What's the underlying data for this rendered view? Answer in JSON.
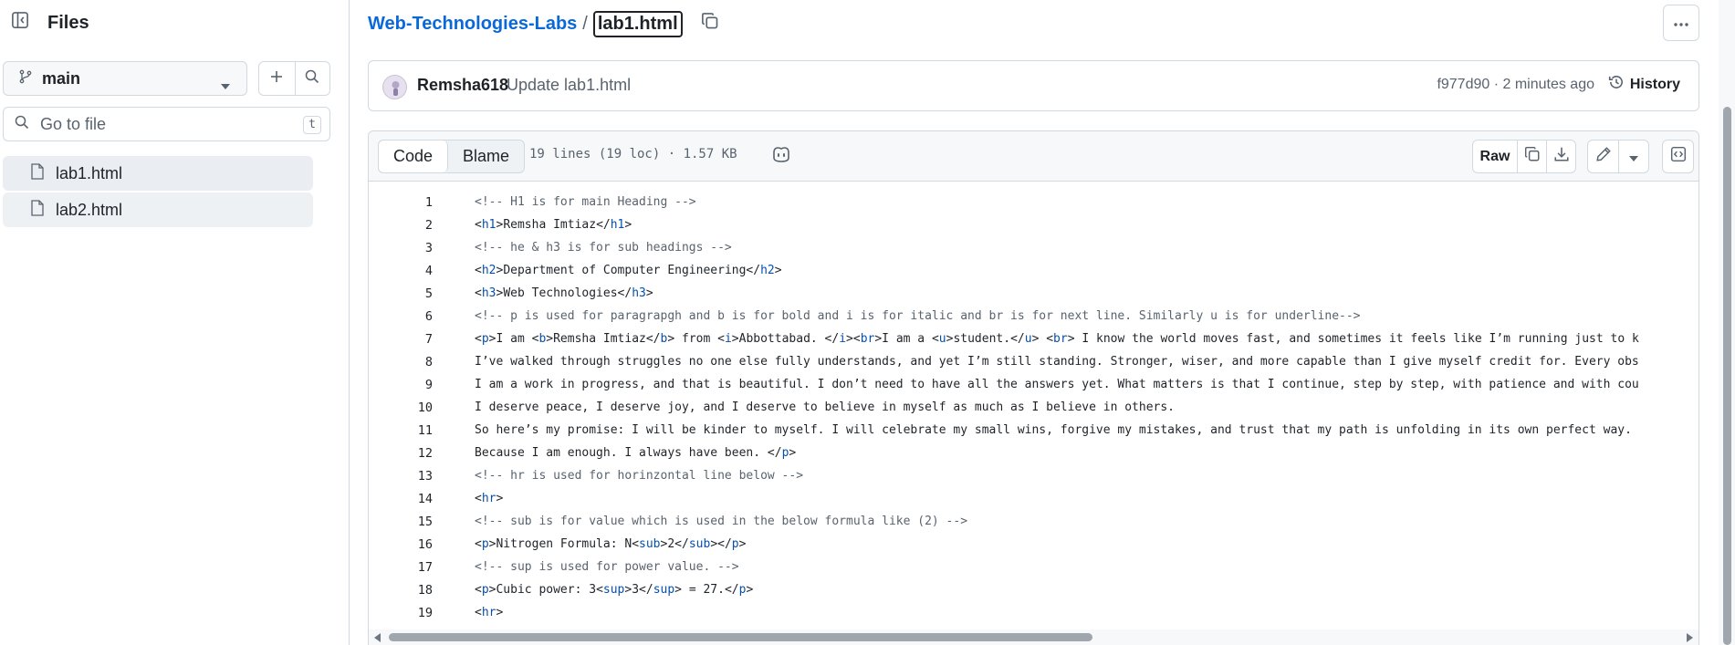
{
  "sidebar": {
    "title": "Files",
    "branch": "main",
    "search_placeholder": "Go to file",
    "search_shortcut": "t",
    "files": [
      {
        "name": "lab1.html",
        "active": true
      },
      {
        "name": "lab2.html",
        "active": false
      }
    ]
  },
  "breadcrumb": {
    "repo": "Web-Technologies-Labs",
    "separator": "/",
    "file": "lab1.html"
  },
  "commit": {
    "author": "Remsha618",
    "message": "Update lab1.html",
    "hash_time": "f977d90 · 2 minutes ago",
    "history_label": "History"
  },
  "file_header": {
    "tabs": [
      "Code",
      "Blame"
    ],
    "active_tab": "Code",
    "meta": "19 lines (19 loc) · 1.57 KB",
    "raw_label": "Raw"
  },
  "code_lines": [
    {
      "n": "1",
      "text": "<!-- H1 is for main Heading -->",
      "comment": true
    },
    {
      "n": "2",
      "text": "<h1>Remsha Imtiaz</h1>",
      "comment": false
    },
    {
      "n": "3",
      "text": "<!-- he & h3 is for sub headings -->",
      "comment": true
    },
    {
      "n": "4",
      "text": "<h2>Department of Computer Engineering</h2>",
      "comment": false
    },
    {
      "n": "5",
      "text": "<h3>Web Technologies</h3>",
      "comment": false
    },
    {
      "n": "6",
      "text": "<!-- p is used for paragrapgh and b is for bold and i is for italic and br is for next line. Similarly u is for underline-->",
      "comment": true
    },
    {
      "n": "7",
      "text": "<p>I am <b>Remsha Imtiaz</b> from <i>Abbottabad. </i><br>I am a <u>student.</u> <br> I know the world moves fast, and sometimes it feels like I’m running just to k",
      "comment": false
    },
    {
      "n": "8",
      "text": "I’ve walked through struggles no one else fully understands, and yet I’m still standing. Stronger, wiser, and more capable than I give myself credit for. Every obs",
      "comment": false
    },
    {
      "n": "9",
      "text": "I am a work in progress, and that is beautiful. I don’t need to have all the answers yet. What matters is that I continue, step by step, with patience and with cou",
      "comment": false
    },
    {
      "n": "10",
      "text": "I deserve peace, I deserve joy, and I deserve to believe in myself as much as I believe in others.",
      "comment": false
    },
    {
      "n": "11",
      "text": "So here’s my promise: I will be kinder to myself. I will celebrate my small wins, forgive my mistakes, and trust that my path is unfolding in its own perfect way.",
      "comment": false
    },
    {
      "n": "12",
      "text": "Because I am enough. I always have been. </p>",
      "comment": false
    },
    {
      "n": "13",
      "text": "<!-- hr is used for horinzontal line below -->",
      "comment": true
    },
    {
      "n": "14",
      "text": "<hr>",
      "comment": false
    },
    {
      "n": "15",
      "text": "<!-- sub is for value which is used in the below formula like (2) -->",
      "comment": true
    },
    {
      "n": "16",
      "text": "<p>Nitrogen Formula: N<sub>2</sub></p>",
      "comment": false
    },
    {
      "n": "17",
      "text": "<!-- sup is used for power value. -->",
      "comment": true
    },
    {
      "n": "18",
      "text": "<p>Cubic power: 3<sup>3</sup> = 27.</p>",
      "comment": false
    },
    {
      "n": "19",
      "text": "<hr>",
      "comment": false
    }
  ],
  "icons": {
    "collapse": "sidebar-collapse-icon",
    "branch": "git-branch-icon",
    "add": "plus-icon",
    "search": "search-icon",
    "file": "file-icon",
    "copy": "copy-icon",
    "more": "kebab-horizontal-icon",
    "history": "history-icon",
    "copilot": "copilot-icon",
    "download": "download-icon",
    "edit": "pencil-icon",
    "symbols": "code-square-icon"
  },
  "colors": {
    "link": "#0969da",
    "tag": "#0550ae",
    "comment": "#59636e",
    "border": "#d1d9e0",
    "active_file_bg": "#eaeef2"
  }
}
